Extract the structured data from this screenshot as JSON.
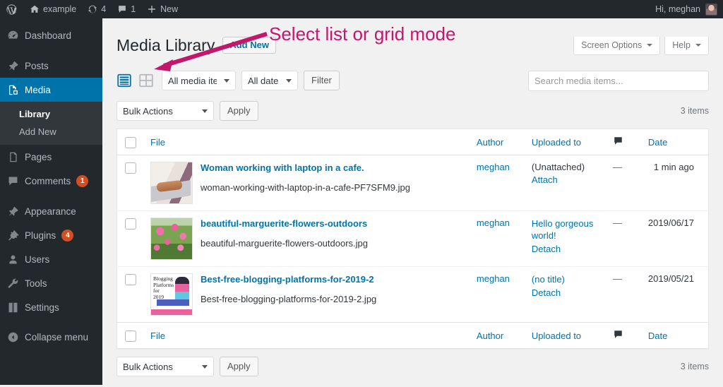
{
  "adminbar": {
    "logo_icon": "wordpress-logo-icon",
    "site_name": "example",
    "updates_icon": "updates-icon",
    "updates_count": "4",
    "comments_icon": "comments-icon",
    "comments_count": "1",
    "new_icon": "plus-icon",
    "new_label": "New",
    "greeting": "Hi, meghan",
    "avatar_name": "user-avatar"
  },
  "sidebar": {
    "items": [
      {
        "label": "Dashboard",
        "icon": "dashboard-icon",
        "current": false
      },
      {
        "label": "Posts",
        "icon": "pin-icon",
        "current": false
      },
      {
        "label": "Media",
        "icon": "media-icon",
        "current": true
      },
      {
        "label": "Pages",
        "icon": "pages-icon",
        "current": false
      },
      {
        "label": "Comments",
        "icon": "comment-icon",
        "current": false,
        "badge": "1"
      },
      {
        "label": "Appearance",
        "icon": "appearance-icon",
        "current": false
      },
      {
        "label": "Plugins",
        "icon": "plugins-icon",
        "current": false,
        "badge": "4"
      },
      {
        "label": "Users",
        "icon": "users-icon",
        "current": false
      },
      {
        "label": "Tools",
        "icon": "tools-icon",
        "current": false
      },
      {
        "label": "Settings",
        "icon": "settings-icon",
        "current": false
      }
    ],
    "submenu": [
      {
        "label": "Library",
        "current": true
      },
      {
        "label": "Add New",
        "current": false
      }
    ],
    "collapse": {
      "label": "Collapse menu",
      "icon": "collapse-arrow-icon"
    }
  },
  "screen_meta": {
    "screen_options_label": "Screen Options",
    "help_label": "Help"
  },
  "header": {
    "title": "Media Library",
    "add_new_label": "Add New"
  },
  "toolbar": {
    "list_view_icon": "list-view-icon",
    "grid_view_icon": "grid-view-icon",
    "media_filter_value": "All media items",
    "date_filter_value": "All dates",
    "filter_label": "Filter"
  },
  "search": {
    "placeholder": "Search media items...",
    "value": ""
  },
  "bulk_top": {
    "select_value": "Bulk Actions",
    "apply_label": "Apply",
    "items_count": "3 items"
  },
  "bulk_bottom": {
    "select_value": "Bulk Actions",
    "apply_label": "Apply",
    "items_count": "3 items"
  },
  "table": {
    "columns": {
      "file": "File",
      "author": "Author",
      "parent": "Uploaded to",
      "comments_icon": "comments-column-icon",
      "date": "Date"
    },
    "rows": [
      {
        "thumb": "woman-laptop-thumbnail",
        "title": "Woman working with laptop in a cafe.",
        "filename": "woman-working-with-laptop-in-a-cafe-PF7SFM9.jpg",
        "author": "meghan",
        "parent": "(Unattached)",
        "parent_is_link": false,
        "attach_action": "Attach",
        "comments": "—",
        "date": "1 min ago"
      },
      {
        "thumb": "flowers-thumbnail",
        "title": "beautiful-marguerite-flowers-outdoors",
        "filename": "beautiful-marguerite-flowers-outdoors.jpg",
        "author": "meghan",
        "parent": "Hello gorgeous world!",
        "parent_is_link": true,
        "attach_action": "Detach",
        "comments": "—",
        "date": "2019/06/17"
      },
      {
        "thumb": "blogging-platforms-thumbnail",
        "title": "Best-free-blogging-platforms-for-2019-2",
        "filename": "Best-free-blogging-platforms-for-2019-2.jpg",
        "author": "meghan",
        "parent": "(no title)",
        "parent_is_link": true,
        "attach_action": "Detach",
        "comments": "—",
        "date": "2019/05/21"
      }
    ]
  },
  "annotation": {
    "text": "Select list or grid mode",
    "color": "#c2186b",
    "arrow_name": "annotation-arrow"
  },
  "thumb_labels": {
    "blog_line1": "Blogging",
    "blog_line2": "Platforms",
    "blog_line3": "for",
    "blog_line4": "2019"
  }
}
